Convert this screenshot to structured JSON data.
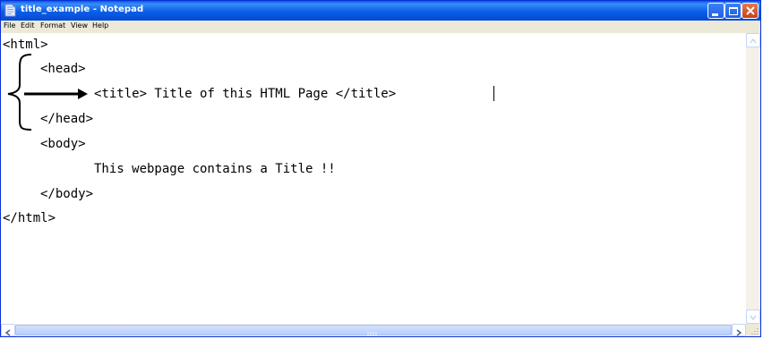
{
  "window": {
    "title": "title_example - Notepad",
    "icon": "notepad-icon"
  },
  "menu": {
    "items": [
      "File",
      "Edit",
      "Format",
      "View",
      "Help"
    ]
  },
  "document": {
    "lines": [
      "<html>",
      "<head>",
      "<title> Title of this HTML Page </title>",
      "</head>",
      "<body>",
      "This webpage contains a Title !!",
      "</body>",
      "</html>"
    ]
  },
  "annotation": {
    "brace": "left-curly-brace",
    "arrow": "right-arrow"
  },
  "colors": {
    "titlebar": "#0a5ee8",
    "menubar": "#ece9d8",
    "scrollbar": "#f3f1ea",
    "close_button": "#c6421c"
  }
}
